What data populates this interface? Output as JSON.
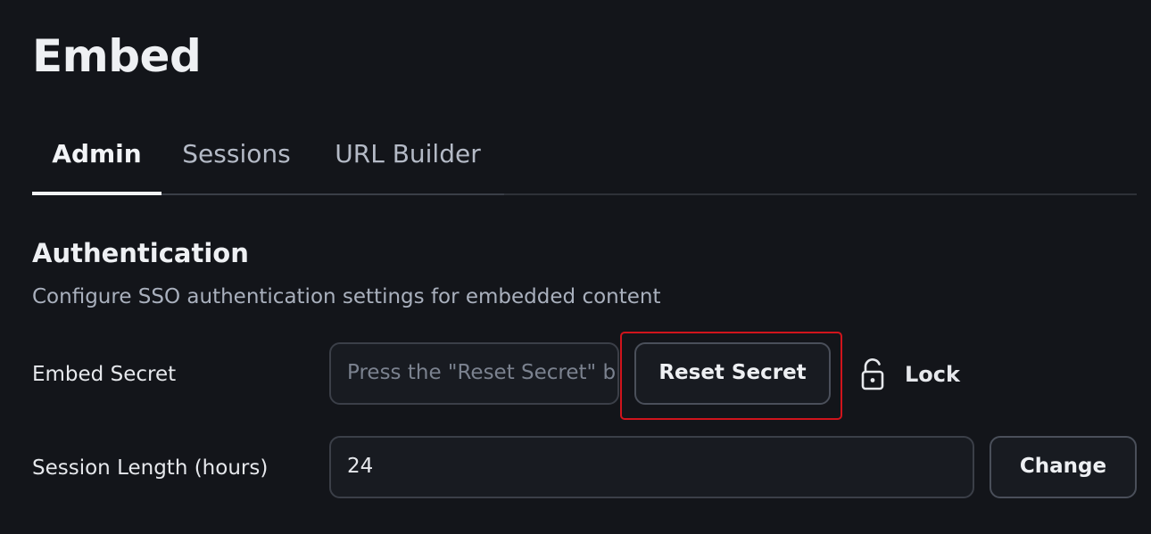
{
  "page": {
    "title": "Embed"
  },
  "tabs": [
    {
      "label": "Admin",
      "active": true
    },
    {
      "label": "Sessions",
      "active": false
    },
    {
      "label": "URL Builder",
      "active": false
    }
  ],
  "section": {
    "title": "Authentication",
    "description": "Configure SSO authentication settings for embedded content"
  },
  "embed_secret": {
    "label": "Embed Secret",
    "placeholder": "Press the \"Reset Secret\" button to generate a secret",
    "reset_button": "Reset Secret",
    "lock_label": "Lock",
    "lock_icon": "unlocked-padlock-icon"
  },
  "session_length": {
    "label": "Session Length (hours)",
    "value": "24",
    "change_button": "Change"
  },
  "colors": {
    "background": "#13151a",
    "highlight": "#d0141c"
  }
}
